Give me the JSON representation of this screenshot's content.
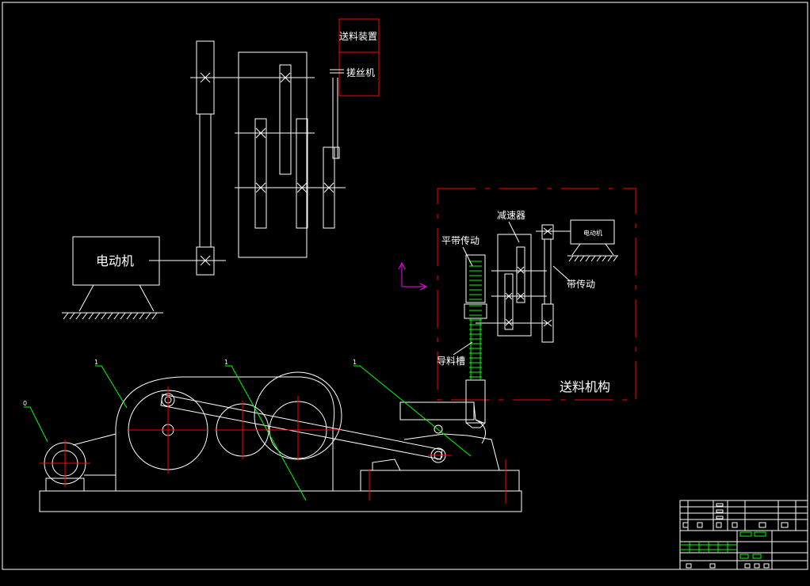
{
  "labels": {
    "feed_device": "送料装置",
    "thread_roller": "搓丝机",
    "motor_left": "电动机",
    "reducer": "减速器",
    "flat_belt": "平带传动",
    "motor_right": "电动机",
    "belt_drive": "带传动",
    "guide_groove": "导料槽",
    "feed_mechanism": "送料机构"
  },
  "leader_marks": [
    "1",
    "1",
    "1",
    "0"
  ],
  "colors": {
    "background": "#000000",
    "line": "#ffffff",
    "center_line": "#ff0000",
    "leader": "#00ff00",
    "ucs": "#ff00ff"
  }
}
